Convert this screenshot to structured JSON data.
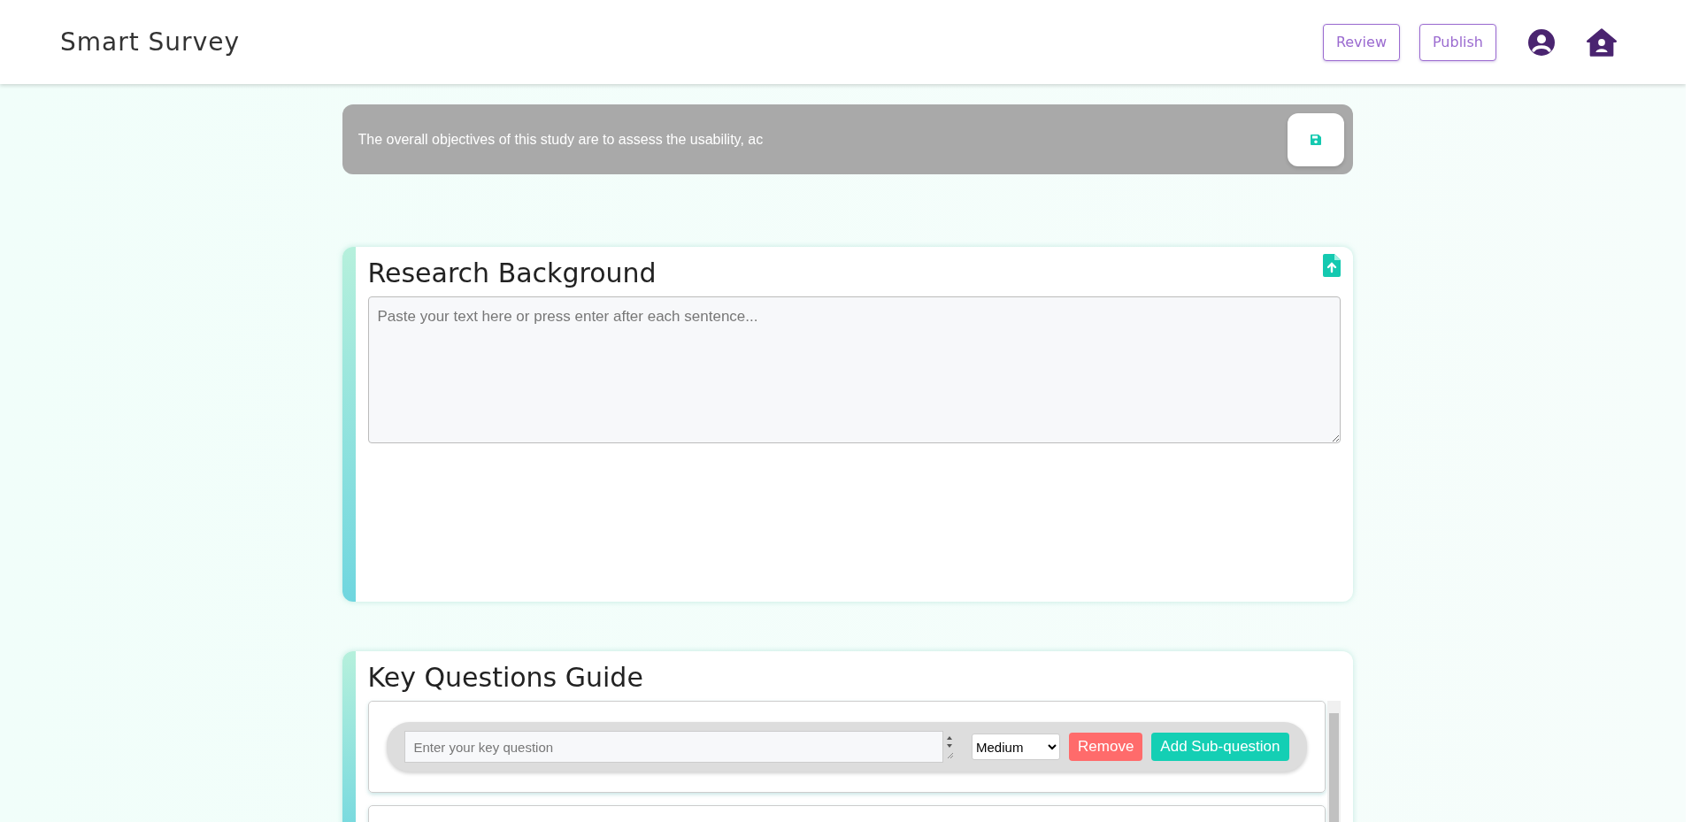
{
  "header": {
    "title": "Smart Survey",
    "buttons": [
      "Review",
      "Publish"
    ]
  },
  "objective": {
    "value": "The overall objectives of this study are to assess the usability, ac"
  },
  "research_background": {
    "heading": "Research Background",
    "placeholder": "Paste your text here or press enter after each sentence..."
  },
  "key_questions": {
    "heading": "Key Questions Guide",
    "questions": [
      {
        "placeholder": "Enter your key question",
        "priority": "Medium",
        "remove": "Remove",
        "add_sub": "Add Sub-question"
      }
    ]
  }
}
